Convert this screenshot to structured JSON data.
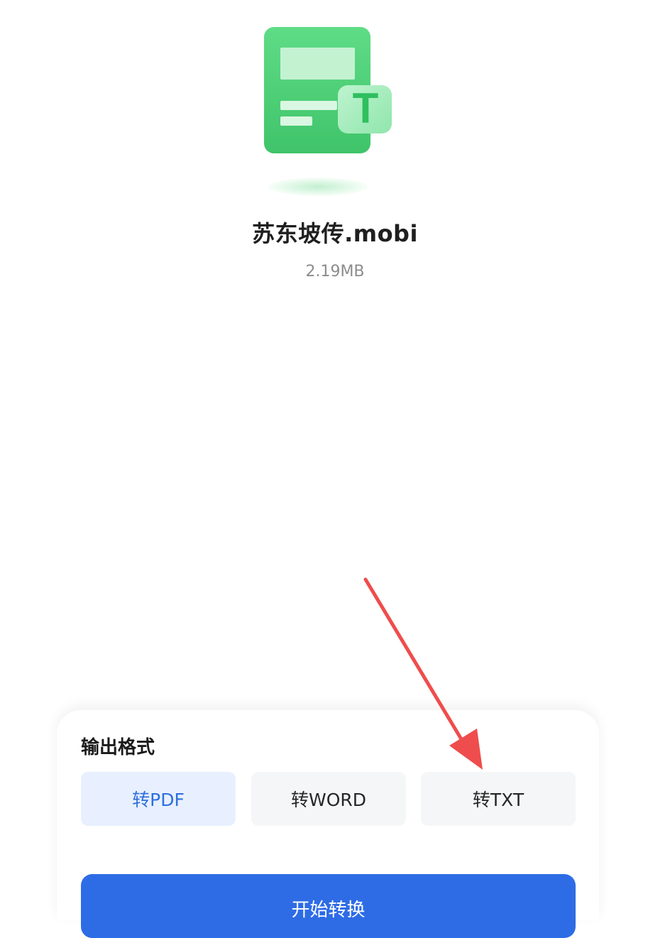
{
  "file": {
    "icon": "document-to-text-icon",
    "badge_letter": "T",
    "name": "苏东坡传.mobi",
    "size": "2.19MB"
  },
  "output": {
    "title": "输出格式",
    "options": [
      {
        "label": "转PDF",
        "selected": true
      },
      {
        "label": "转WORD",
        "selected": false
      },
      {
        "label": "转TXT",
        "selected": false
      }
    ],
    "start_label": "开始转换"
  },
  "colors": {
    "accent": "#2e6ce6",
    "selected_bg": "#e8f0ff",
    "selected_text": "#2f6fde",
    "option_bg": "#f5f6f7",
    "icon_green": "#4fd07a",
    "annotation_arrow": "#ef4d4d"
  },
  "annotation": {
    "icon": "red-arrow-icon",
    "points_to": "转TXT"
  }
}
